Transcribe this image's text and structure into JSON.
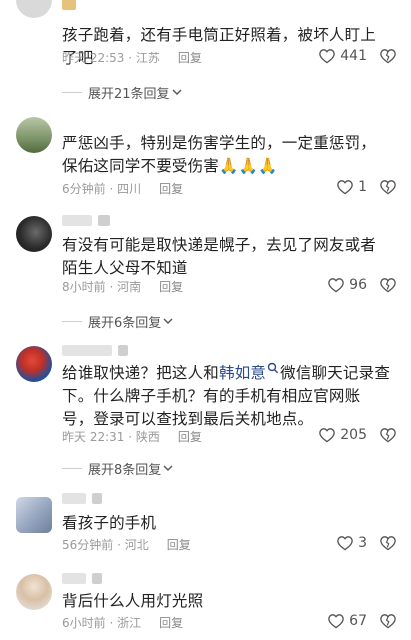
{
  "comments": [
    {
      "text": "孩子跑着，还有手电筒正好照着，被坏人盯上了吧",
      "time": "昨天 22:53 · 江苏",
      "reply": "回复",
      "likes": "441",
      "expand": "展开21条回复"
    },
    {
      "text": "严惩凶手，特别是伤害学生的，一定重惩罚，保佑这同学不要受伤害🙏🙏🙏",
      "time": "6分钟前 · 四川",
      "reply": "回复",
      "likes": "1"
    },
    {
      "text": "有没有可能是取快递是幌子，去见了网友或者陌生人父母不知道",
      "time": "8小时前 · 河南",
      "reply": "回复",
      "likes": "96",
      "expand": "展开6条回复"
    },
    {
      "text_before": "给谁取快递？把这人和",
      "mention": "韩如意",
      "text_after": "微信聊天记录查下。什么牌子手机？有的手机有相应官网账号，登录可以查找到最后关机地点。",
      "time": "昨天 22:31 · 陕西",
      "reply": "回复",
      "likes": "205",
      "expand": "展开8条回复"
    },
    {
      "text": "看孩子的手机",
      "time": "56分钟前 · 河北",
      "reply": "回复",
      "likes": "3"
    },
    {
      "text": "背后什么人用灯光照",
      "time": "6小时前 · 浙江",
      "reply": "回复",
      "likes": "67"
    }
  ],
  "colors": {
    "mention": "#2a4a8c",
    "meta": "#9a9a9a",
    "divider": "#cfcfcf"
  }
}
